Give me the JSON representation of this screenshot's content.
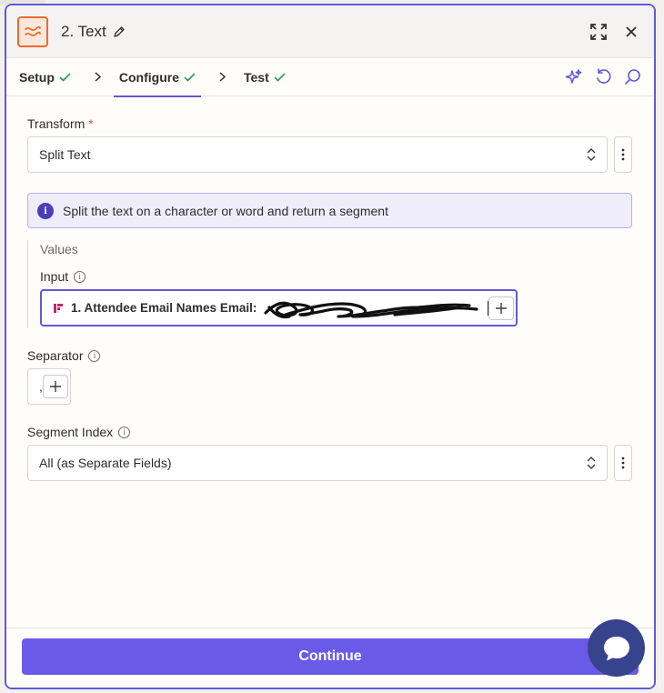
{
  "header": {
    "title": "2. Text",
    "app_icon": "zapier-formatter-icon",
    "edit_icon": "pencil-icon",
    "expand_icon": "expand-icon",
    "close_icon": "close-icon"
  },
  "tabs": [
    {
      "label": "Setup",
      "done": true
    },
    {
      "label": "Configure",
      "done": true,
      "active": true
    },
    {
      "label": "Test",
      "done": true
    }
  ],
  "tab_tools": [
    "sparkle-icon",
    "undo-icon",
    "search-icon"
  ],
  "transform": {
    "label": "Transform",
    "required_mark": "*",
    "value": "Split Text"
  },
  "note": {
    "text": "Split the text on a character or word and return a segment"
  },
  "values": {
    "heading": "Values",
    "input": {
      "label": "Input",
      "pill_label": "1. Attendee Email Names Email:"
    }
  },
  "separator": {
    "label": "Separator",
    "value": ","
  },
  "segment_index": {
    "label": "Segment Index",
    "value": "All (as Separate Fields)"
  },
  "footer": {
    "continue_label": "Continue"
  },
  "colors": {
    "accent": "#6259d8",
    "button": "#695be8",
    "brand_orange": "#ea6b2c",
    "chat": "#37438c"
  }
}
